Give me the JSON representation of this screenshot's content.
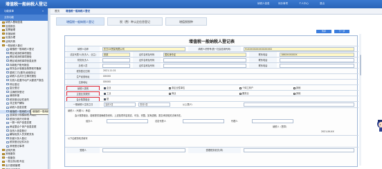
{
  "app": {
    "title": "增值税一般纳税人登记",
    "top_links": [
      "纳税人信息",
      "待办事项",
      "个人中心",
      "退出"
    ]
  },
  "sidebar": {
    "header": "功能菜单",
    "header2": "业务功能",
    "items": [
      {
        "label": "纳税人基础信息",
        "type": "folder"
      },
      {
        "label": "信息报告",
        "type": "folder"
      },
      {
        "label": "发票管理",
        "type": "folder"
      },
      {
        "label": "申报纳税",
        "type": "folder"
      },
      {
        "label": "优惠办理",
        "type": "folder"
      },
      {
        "label": "证明开具",
        "type": "folder"
      },
      {
        "label": "一般纳税人登记",
        "type": "folder"
      },
      {
        "label": "增值税一般纳税人登记",
        "type": "doc"
      },
      {
        "label": "跨区域涉税事项报告",
        "type": "doc"
      },
      {
        "label": "跨区域涉税事项报验",
        "type": "doc"
      },
      {
        "label": "跨区域涉税事项信息反馈",
        "type": "doc"
      },
      {
        "label": "存款账户账号报告",
        "type": "doc"
      },
      {
        "label": "财务会计制度及核算软件备案",
        "type": "doc"
      },
      {
        "label": "银税三方(委托)划缴协议",
        "type": "doc"
      },
      {
        "label": "纳税人合并分立情况报告",
        "type": "doc"
      },
      {
        "label": "欠税人处置不动产大额资产报告",
        "type": "doc"
      },
      {
        "label": "停业登记",
        "type": "doc"
      },
      {
        "label": "复业登记",
        "type": "doc"
      },
      {
        "label": "注销税务登记",
        "type": "doc"
      },
      {
        "label": "清税申报",
        "type": "doc"
      },
      {
        "label": "税务登记证件遗失",
        "type": "doc"
      },
      {
        "label": "非正常户解除",
        "type": "doc"
      },
      {
        "label": "纳税人信息变更",
        "type": "doc"
      },
      {
        "label": "增值税一般纳税人登记",
        "type": "doc",
        "selected": true
      },
      {
        "label": "选择按小规模纳税人纳税",
        "type": "doc"
      },
      {
        "label": "税务行政许可申请",
        "type": "doc"
      },
      {
        "label": "一照一码户信息变更",
        "type": "doc"
      },
      {
        "label": "两证整合个体户信息变更",
        "type": "doc"
      },
      {
        "label": "自然人信息登记",
        "type": "doc"
      },
      {
        "label": "解除相关人员关联关系",
        "type": "doc"
      },
      {
        "label": "扣缴义务人登记",
        "type": "doc"
      },
      {
        "label": "税务登记证件补办",
        "type": "doc"
      },
      {
        "label": "其他登记事项",
        "type": "doc"
      },
      {
        "label": "证明开具",
        "type": "folder"
      },
      {
        "label": "其他服务",
        "type": "folder"
      },
      {
        "label": "一般服务",
        "type": "folder"
      },
      {
        "label": "一般业务(税)专区",
        "type": "folder"
      },
      {
        "label": "出口退税管理",
        "type": "folder"
      },
      {
        "label": "税收法律救济",
        "type": "folder"
      },
      {
        "label": "文书查询下载",
        "type": "folder"
      }
    ],
    "tooltip": "增值税一般纳税人登记-增值税一般纳税人登记"
  },
  "tabs": {
    "items": [
      "首页",
      "增值税一般纳税人登记"
    ],
    "active": 1
  },
  "steps": [
    {
      "label": "增值税一般纳税人登记",
      "active": true
    },
    {
      "label": "税（费）种认定信息登记",
      "active": false
    },
    {
      "label": "增值税税种",
      "active": false
    }
  ],
  "actions": {
    "save": "暂存",
    "next": "下一步"
  },
  "form": {
    "title": "增值税一般纳税人登记表",
    "rows": [
      {
        "l1": "纳税人名称",
        "v1": "东方XX贸易有限公司",
        "l2": "纳税人识别号(统一社会信用代码)",
        "v2": "91XXXXXXXXXXXXXXXX"
      },
      {
        "l1": "法定代表人(负责人、业主)",
        "v1": "张某",
        "l2": "证件名称及号码",
        "v2": "居民身份证",
        "l3": "联系电话",
        "v3": "186XXXXXXXX"
      },
      {
        "l1": "财务负责人",
        "v1": "",
        "l2": "证件名称及号码",
        "v2": "",
        "l3": "联系电话",
        "v3": ""
      },
      {
        "l1": "办税人员",
        "v1": "",
        "l2": "证件名称及号码",
        "v2": "",
        "l3": "联系电话",
        "v3": ""
      },
      {
        "l1": "税务登记日期",
        "v1": "2021-11-01"
      },
      {
        "l1": "生产经营地址",
        "v1": "XXXXX"
      },
      {
        "l1": "注册地址",
        "v1": "XXXXX"
      }
    ],
    "type_label": "纳税人类别",
    "type_opts": [
      "企业",
      "非企业性单位",
      "个体工商户",
      "其他"
    ],
    "biz_label": "主营业务类别",
    "biz_opts": [
      "工业",
      "商业",
      "服务业",
      "其他"
    ],
    "acct_label": "会计核算健全",
    "acct_value": "是",
    "period_label": "一般纳税人生效之日",
    "period_opts": [
      "当月1日",
      "次月1日"
    ],
    "period_note": "从上表(*)",
    "declaration": "纳税人（代理人）承诺：",
    "declaration_text": "会计核算健全，能够提供准确税务资料，上述各项内容真实、可靠、完整。如有虚假，愿意承担相关法律责任。",
    "sign_labels": [
      "经办人",
      "法定代表人",
      "代理人"
    ],
    "sign_date": "2021-XX-XX",
    "seal_label": "纳税人（签章）",
    "agency_label": "以下由税务机关填写",
    "agency_fields": [
      "受理人",
      "受理税务机关(章)"
    ]
  },
  "right_buttons": [
    "查询帮助",
    "办税指南"
  ]
}
